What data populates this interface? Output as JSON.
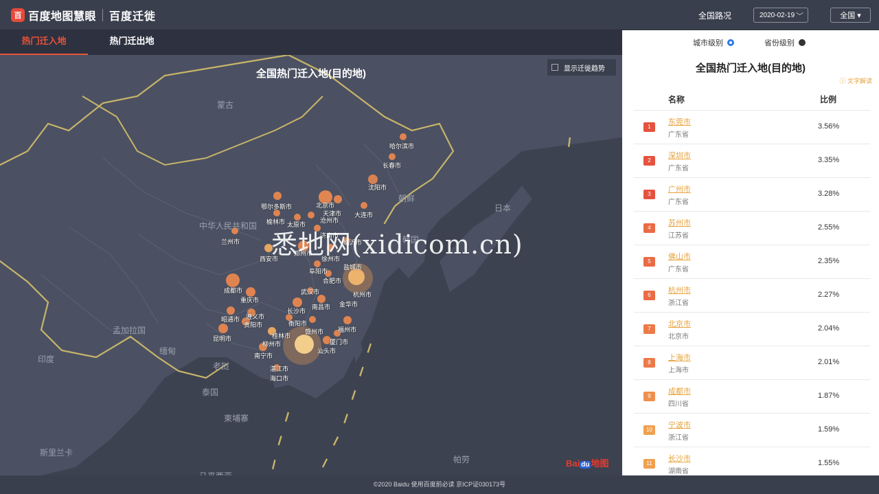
{
  "header": {
    "logo_icon": "百",
    "logo_text": "百度地图慧眼",
    "product_title": "百度迁徙",
    "route_label": "全国路况",
    "date_value": "2020-02-19",
    "region_value": "全国 ▾"
  },
  "tabs": [
    {
      "label": "热门迁入地",
      "active": true
    },
    {
      "label": "热门迁出地",
      "active": false
    }
  ],
  "map": {
    "title": "全国热门迁入地(目的地)",
    "trend_toggle_label": "显示迁徙趋势",
    "regions": [
      "蒙古",
      "朝鲜",
      "日本",
      "中华人民共和国",
      "韩国",
      "孟加拉国",
      "缅甸",
      "老挝",
      "泰国",
      "柬埔寨",
      "印度",
      "斯里兰卡",
      "马来西亚",
      "帕劳"
    ],
    "cities": [
      "哈尔滨市",
      "长春市",
      "沈阳市",
      "大连市",
      "鄂尔多斯市",
      "北京市",
      "天津市",
      "榆林市",
      "太原市",
      "沧州市",
      "济南市",
      "兰州市",
      "西安市",
      "郑州市",
      "徐州市",
      "临沂市",
      "阜阳市",
      "合肥市",
      "盐城市",
      "杭州市",
      "金华市",
      "成都市",
      "重庆市",
      "武汉市",
      "长沙市",
      "南昌市",
      "昭通市",
      "遵义市",
      "贵阳市",
      "衡阳市",
      "赣州市",
      "福州市",
      "昆明市",
      "桂林市",
      "柳州市",
      "厦门市",
      "汕头市",
      "南宁市",
      "湛江市",
      "海口市"
    ],
    "watermark": "悉地网(xidicom.cn)",
    "baidu_logo_left": "Bai",
    "baidu_logo_du": "du",
    "baidu_logo_right": "地图"
  },
  "panel": {
    "city_level_label": "城市级别",
    "province_level_label": "省份级别",
    "title": "全国热门迁入地(目的地)",
    "explain_label": "ⓘ 文字解读",
    "col_name": "名称",
    "col_ratio": "比例",
    "rows": [
      {
        "rank": "1",
        "city": "东莞市",
        "province": "广东省",
        "ratio": "3.56%",
        "color": "#e5533e"
      },
      {
        "rank": "2",
        "city": "深圳市",
        "province": "广东省",
        "ratio": "3.35%",
        "color": "#e5533e"
      },
      {
        "rank": "3",
        "city": "广州市",
        "province": "广东省",
        "ratio": "3.28%",
        "color": "#e5533e"
      },
      {
        "rank": "4",
        "city": "苏州市",
        "province": "江苏省",
        "ratio": "2.55%",
        "color": "#ea6b45"
      },
      {
        "rank": "5",
        "city": "佛山市",
        "province": "广东省",
        "ratio": "2.35%",
        "color": "#ea6b45"
      },
      {
        "rank": "6",
        "city": "杭州市",
        "province": "浙江省",
        "ratio": "2.27%",
        "color": "#ea6b45"
      },
      {
        "rank": "7",
        "city": "北京市",
        "province": "北京市",
        "ratio": "2.04%",
        "color": "#ec7a48"
      },
      {
        "rank": "8",
        "city": "上海市",
        "province": "上海市",
        "ratio": "2.01%",
        "color": "#ec7a48"
      },
      {
        "rank": "9",
        "city": "成都市",
        "province": "四川省",
        "ratio": "1.87%",
        "color": "#ef8f4d"
      },
      {
        "rank": "10",
        "city": "宁波市",
        "province": "浙江省",
        "ratio": "1.59%",
        "color": "#f0a04f"
      },
      {
        "rank": "11",
        "city": "长沙市",
        "province": "湖南省",
        "ratio": "1.55%",
        "color": "#f0a04f"
      }
    ]
  },
  "footer": {
    "text": "©2020 Baidu 使用百度前必读 京ICP证030173号"
  }
}
